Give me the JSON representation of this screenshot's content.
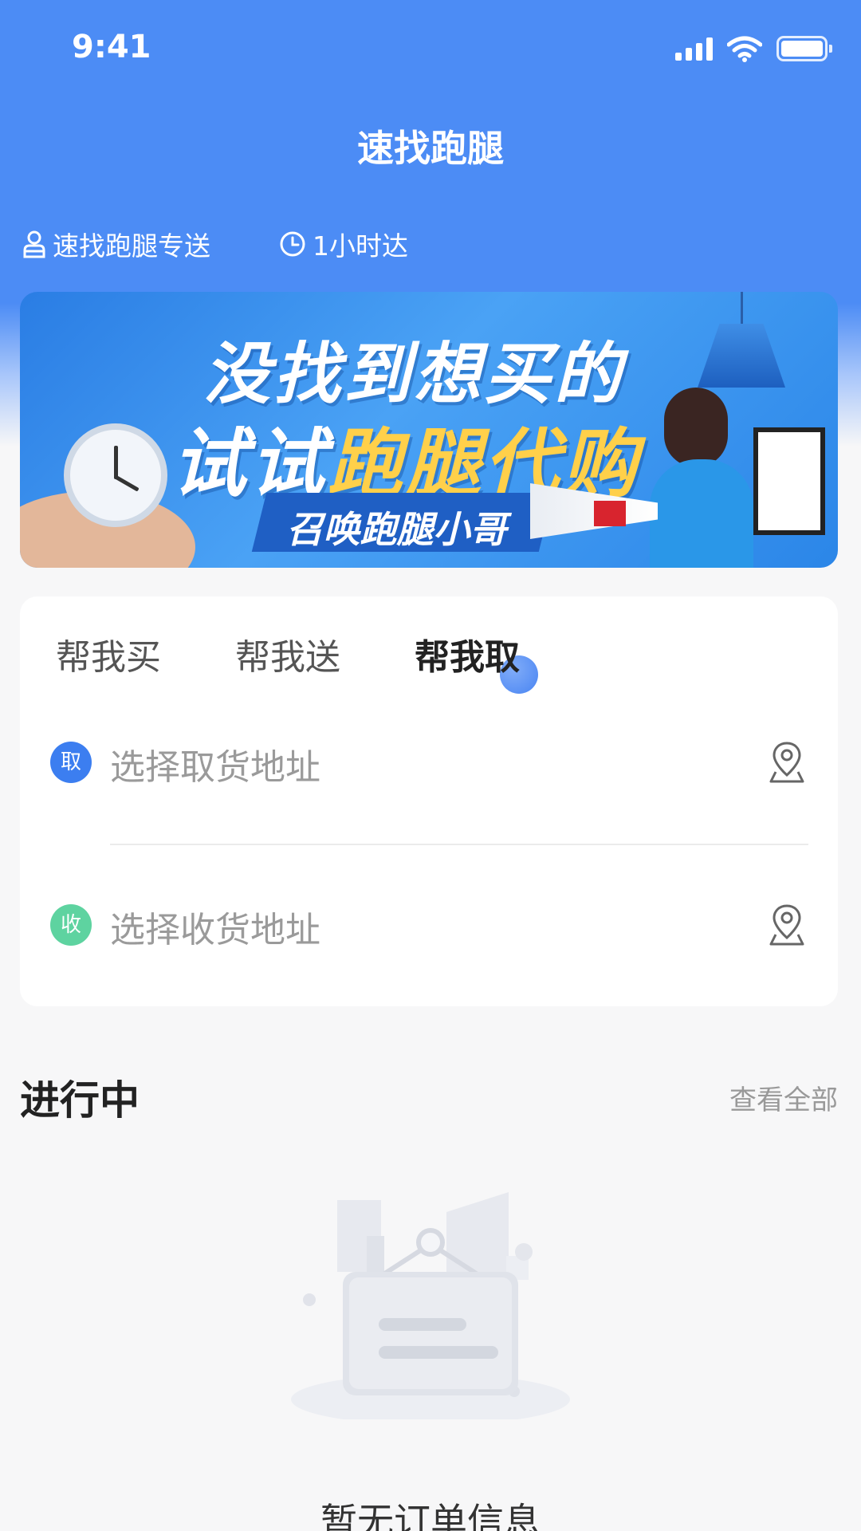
{
  "status_bar": {
    "time": "9:41"
  },
  "header": {
    "title": "速找跑腿"
  },
  "features": [
    {
      "icon": "courier-icon",
      "label": "速找跑腿专送"
    },
    {
      "icon": "clock-icon",
      "label": "1小时达"
    }
  ],
  "banner": {
    "line1": "没找到想买的",
    "line2_prefix": "试试",
    "line2_highlight": "跑腿代购",
    "tag": "召唤跑腿小哥"
  },
  "order_card": {
    "tabs": [
      {
        "label": "帮我买",
        "active": false
      },
      {
        "label": "帮我送",
        "active": false
      },
      {
        "label": "帮我取",
        "active": true
      }
    ],
    "pickup": {
      "badge": "取",
      "placeholder": "选择取货地址",
      "icon": "location-pin-icon"
    },
    "delivery": {
      "badge": "收",
      "placeholder": "选择收货地址",
      "icon": "location-pin-icon"
    }
  },
  "in_progress": {
    "title": "进行中",
    "view_all": "查看全部"
  },
  "empty_state": {
    "message": "暂无订单信息"
  },
  "colors": {
    "primary": "#4C8CF5",
    "pickup_badge": "#3C7EF0",
    "delivery_badge": "#5ED3A0",
    "highlight": "#FFD04A"
  }
}
